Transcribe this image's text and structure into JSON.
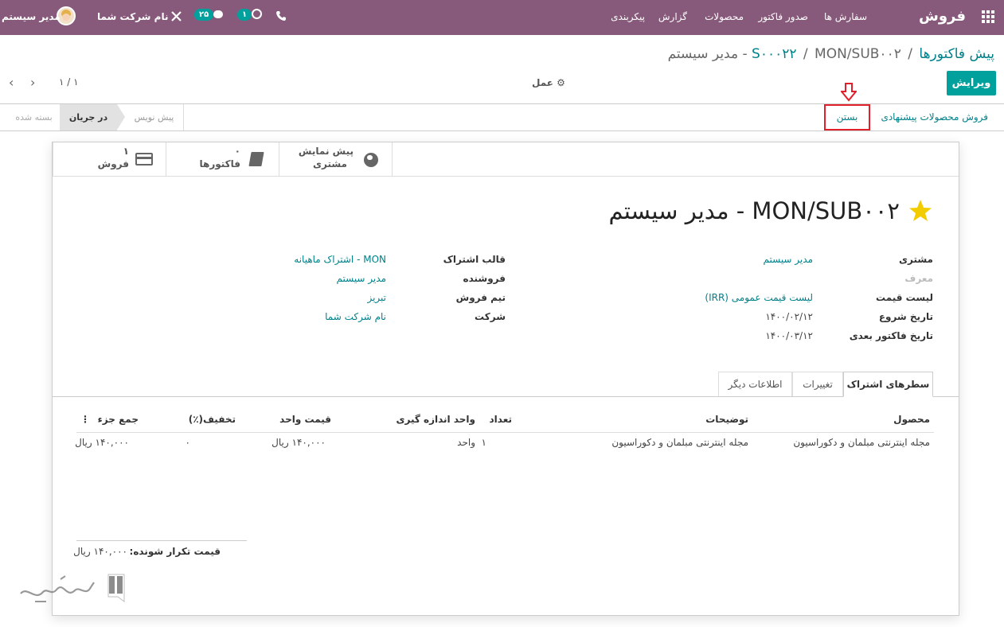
{
  "navbar": {
    "app_name": "فروش",
    "menu": [
      "سفارش ها",
      "صدور فاکتور",
      "محصولات",
      "گزارش",
      "پیکربندی"
    ],
    "company": "نام شرکت شما",
    "user": "مدیر سیستم",
    "messages_count": "۲۵",
    "activities_count": "۱"
  },
  "breadcrumb": {
    "item1": "پیش فاکتورها",
    "sep": "/",
    "item2": "S۰۰۰۲۲",
    "current": "MON/SUB۰۰۲ - مدیر سیستم"
  },
  "control": {
    "edit_label": "ویرایش",
    "action_label": "عمل",
    "pager": "۱ / ۱"
  },
  "statusbar": {
    "upsell_label": "فروش محصولات پیشنهادی",
    "close_label": "بستن",
    "stages": [
      "در جریان",
      "پیش نویس",
      "بسته شده"
    ],
    "active_stage": "در جریان"
  },
  "stat_buttons": {
    "sales_count": "۱",
    "sales_label": "فروش",
    "invoices_count": "۰",
    "invoices_label": "فاکتورها",
    "preview_line1": "پیش نمایش",
    "preview_line2": "مشتری"
  },
  "record": {
    "title": "MON/SUB۰۰۲ - مدیر سیستم",
    "star_color": "#f3cc00"
  },
  "fields_right": [
    {
      "label": "مشتری",
      "value": "مدیر سیستم",
      "link": true
    },
    {
      "label": "معرف",
      "value": "",
      "muted": true
    },
    {
      "label": "لیست قیمت",
      "value": "لیست قیمت عمومی (IRR)",
      "link": true
    },
    {
      "label": "تاریخ شروع",
      "value": "۱۴۰۰/۰۲/۱۲"
    },
    {
      "label": "تاریخ فاکتور بعدی",
      "value": "۱۴۰۰/۰۳/۱۲"
    }
  ],
  "fields_left": [
    {
      "label": "قالب اشتراک",
      "value": "MON - اشتراک ماهیانه"
    },
    {
      "label": "فروشنده",
      "value": "مدیر سیستم"
    },
    {
      "label": "تیم فروش",
      "value": "تبریز"
    },
    {
      "label": "شرکت",
      "value": "نام شرکت شما"
    }
  ],
  "tabs": {
    "lines": "سطرهای اشتراک",
    "changes": "تغییرات",
    "other": "اطلاعات دیگر"
  },
  "table": {
    "headers": {
      "product": "محصول",
      "description": "توضیحات",
      "qty": "تعداد",
      "uom": "واحد اندازه گیری",
      "price": "قیمت واحد",
      "discount": "تخفیف(٪)",
      "subtotal": "جمع جزء"
    },
    "rows": [
      {
        "product": "مجله اینترنتی مبلمان و دکوراسیون",
        "description": "مجله اینترنتی مبلمان و دکوراسیون",
        "qty": "۱",
        "uom": "واحد",
        "price": "۱۴۰,۰۰۰ ریال",
        "discount": "۰",
        "subtotal": "۱۴۰,۰۰۰ ریال"
      }
    ]
  },
  "total": {
    "label": "قیمت تکرار شونده:",
    "value": "۱۴۰,۰۰۰ ریال"
  },
  "colors": {
    "navbar": "#875a7b",
    "primary": "#00a09d",
    "link": "#00818a",
    "highlight_box": "#e0202a"
  }
}
